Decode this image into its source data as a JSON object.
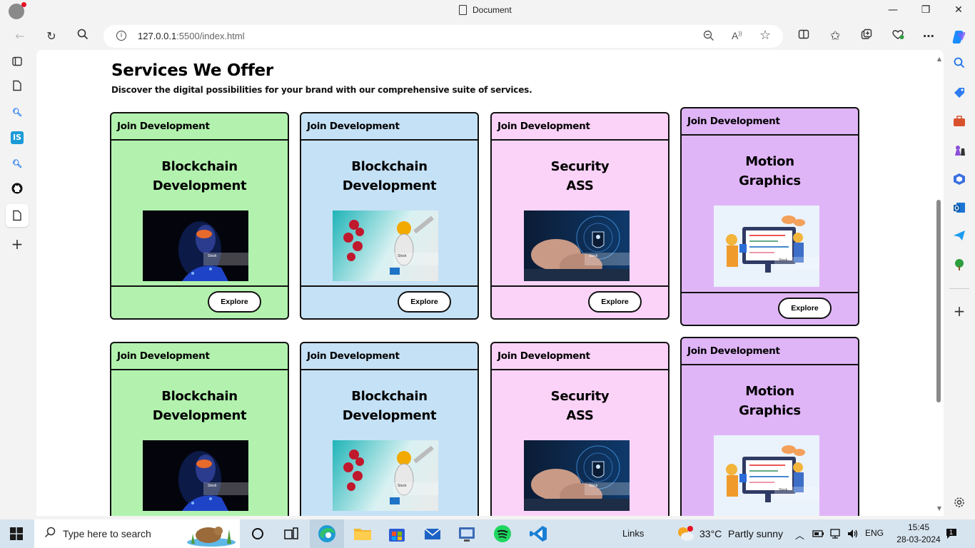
{
  "window": {
    "title": "Document",
    "minimize": "—",
    "restore": "❐",
    "close": "✕"
  },
  "toolbar": {
    "url_host": "127.0.0.1",
    "url_rest": ":5500/index.html"
  },
  "page": {
    "title": "Services We Offer",
    "subtitle": "Discover the digital possibilities for your brand with our comprehensive suite of services."
  },
  "cards": [
    {
      "header": "Join Development",
      "title_line1": "Blockchain",
      "title_line2": "Development",
      "button": "Explore",
      "color": "#b2f2ae",
      "image": "blockchain-person-image"
    },
    {
      "header": "Join Development",
      "title_line1": "Blockchain",
      "title_line2": "Development",
      "button": "Explore",
      "color": "#c5e1f5",
      "image": "robot-balloons-image"
    },
    {
      "header": "Join Development",
      "title_line1": "Security",
      "title_line2": "ASS",
      "button": "Explore",
      "color": "#fcd3f8",
      "image": "keyboard-security-image"
    },
    {
      "header": "Join Development",
      "title_line1": "Motion",
      "title_line2": "Graphics",
      "button": "Explore",
      "color": "#e0b5f7",
      "image": "motion-graphics-image"
    },
    {
      "header": "Join Development",
      "title_line1": "Blockchain",
      "title_line2": "Development",
      "color": "#b2f2ae",
      "image": "blockchain-person-image"
    },
    {
      "header": "Join Development",
      "title_line1": "Blockchain",
      "title_line2": "Development",
      "color": "#c5e1f5",
      "image": "robot-balloons-image"
    },
    {
      "header": "Join Development",
      "title_line1": "Security",
      "title_line2": "ASS",
      "color": "#fcd3f8",
      "image": "keyboard-security-image"
    },
    {
      "header": "Join Development",
      "title_line1": "Motion",
      "title_line2": "Graphics",
      "color": "#e0b5f7",
      "image": "motion-graphics-image"
    }
  ],
  "image_watermark": "Stock",
  "taskbar": {
    "search_placeholder": "Type here to search",
    "links": "Links",
    "temperature": "33°C",
    "weather": "Partly sunny",
    "language": "ENG",
    "time": "15:45",
    "date": "28-03-2024",
    "notification_count": "1"
  }
}
